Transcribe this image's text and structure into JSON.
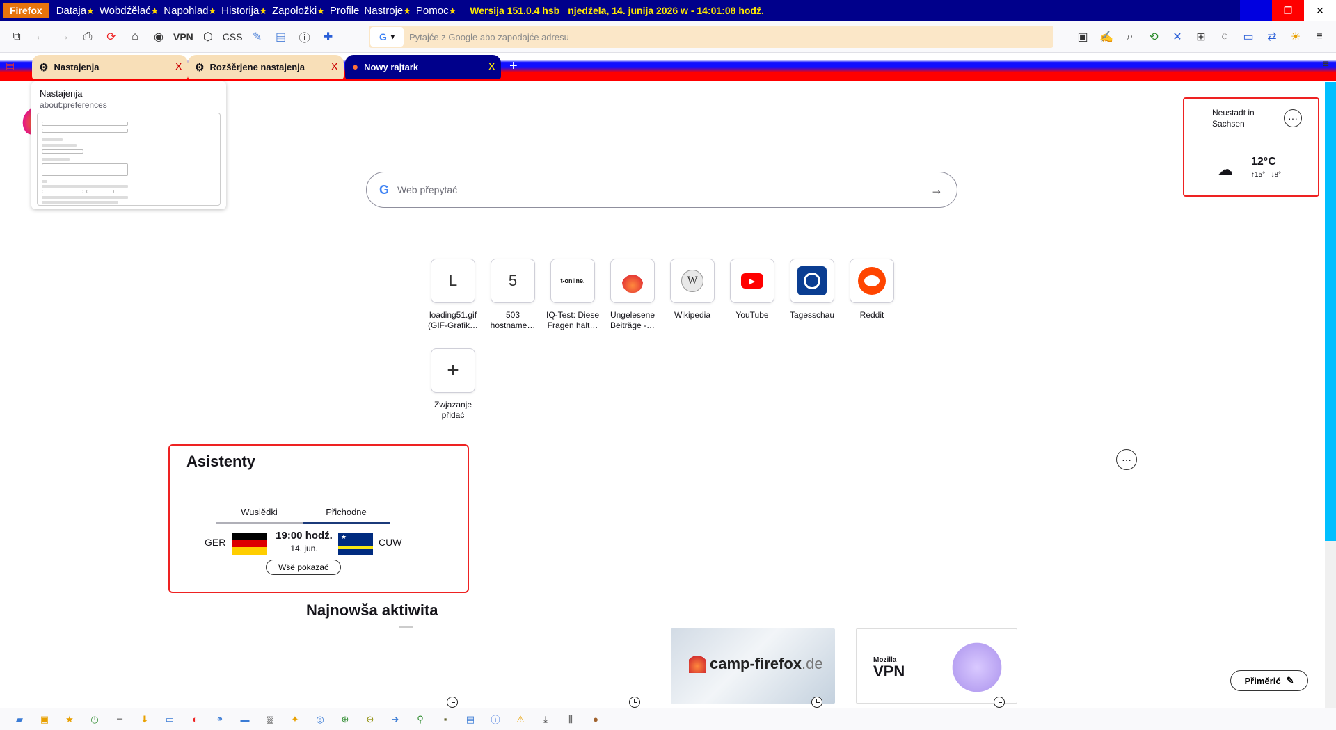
{
  "menubar": {
    "app_button": "Firefox",
    "items": [
      {
        "label": "Dataja",
        "star": "★"
      },
      {
        "label": "Wobdźěłać",
        "star": "★"
      },
      {
        "label": "Napohlad",
        "star": "★"
      },
      {
        "label": "Historija",
        "star": "★"
      },
      {
        "label": "Zapołožki",
        "star": "★"
      },
      {
        "label": "Profile",
        "star": ""
      },
      {
        "label": "Nastroje",
        "star": "★"
      },
      {
        "label": "Pomoc",
        "star": "★"
      }
    ],
    "version": "Wersija 151.0.4 hsb",
    "datetime": "njedźela, 14. junija 2026 w - 14:01:08 hodź.",
    "close_glyph": "✕",
    "max_glyph": "❐"
  },
  "navbar": {
    "vpn_label": "VPN",
    "css_label": "CSS",
    "search_engine": "G",
    "url_placeholder": "Pytajće z Google abo zapodajće adresu"
  },
  "tabs": [
    {
      "title": "Nastajenja",
      "close": "X",
      "icon": "gear-icon"
    },
    {
      "title": "Rozšěrjene nastajenja",
      "close": "X",
      "icon": "gear-icon"
    },
    {
      "title": "Nowy rajtark",
      "close": "X",
      "icon": "firefox-icon"
    }
  ],
  "new_tab_glyph": "+",
  "tab_preview": {
    "title": "Nastajenja",
    "url": "about:preferences"
  },
  "search": {
    "placeholder": "Web přepytać",
    "engine_letter": "G"
  },
  "shortcuts": [
    {
      "label": "loading51.gif (GIF-Grafik…",
      "icon": "L"
    },
    {
      "label": "503 hostname…",
      "icon": "5"
    },
    {
      "label": "IQ-Test: Diese Fragen halt…",
      "icon": "t-online."
    },
    {
      "label": "Ungelesene Beiträge -…",
      "icon": "flame-icon"
    },
    {
      "label": "Wikipedia",
      "icon": "W"
    },
    {
      "label": "YouTube",
      "icon": "▶"
    },
    {
      "label": "Tagesschau",
      "icon": "tagesschau-icon"
    },
    {
      "label": "Reddit",
      "icon": "reddit-icon"
    }
  ],
  "add_shortcut": {
    "label": "Zwjazanje přidać",
    "icon": "+"
  },
  "weather": {
    "city": "Neustadt in Sachsen",
    "temp": "12°C",
    "high": "↑15°",
    "low": "↓8°",
    "more": "···"
  },
  "sports_widget": {
    "title": "Asistenty",
    "tabs": [
      "Wuslědki",
      "Přichodne"
    ],
    "active_tab": 1,
    "match": {
      "home": "GER",
      "away": "CUW",
      "time": "19:00 hodź.",
      "date": "14. jun."
    },
    "show_all": "Wšě pokazać"
  },
  "recent": {
    "title": "Najnowša aktiwita",
    "cards": [
      {
        "text": "camp-firefox",
        "suffix": ".de"
      },
      {
        "brand_small": "Mozilla",
        "brand_big": "VPN"
      }
    ]
  },
  "edit_button": "Přiměrić",
  "more_dots": "···",
  "colors": {
    "menubar_bg": "#00008b",
    "firefox_button": "#e8740c",
    "highlight_text": "#ffea00",
    "widget_border": "#e22222",
    "scroll_thumb": "#00bfff"
  }
}
